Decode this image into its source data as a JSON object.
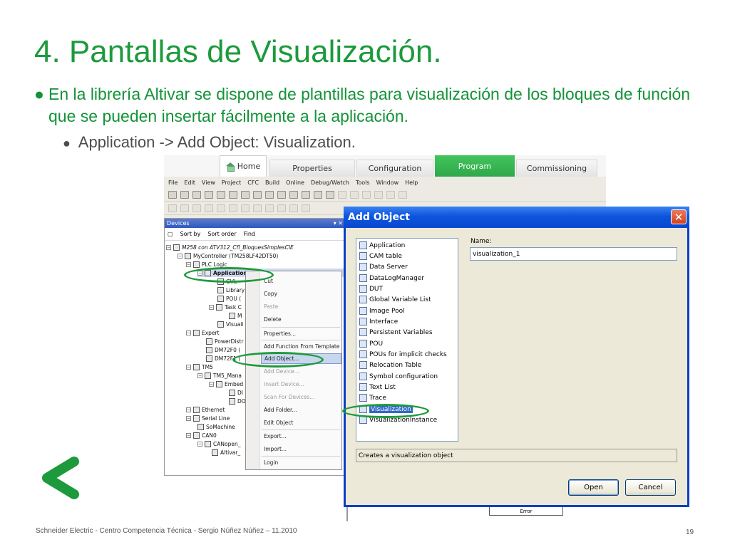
{
  "slide": {
    "title": "4. Pantallas de Visualización.",
    "bullet1": "En la librería Altivar se dispone de plantillas para visualización de los bloques de función que se pueden insertar fácilmente a la aplicación.",
    "bullet2": "Application -> Add Object: Visualization.",
    "bullet_glyph": "●",
    "footer": "Schneider Electric - Centro Competencia Técnica - Sergio Núñez Núñez – 11.2010",
    "page": "19",
    "accent_color": "#1c9a3c"
  },
  "ribbon": {
    "tabs": [
      "Home",
      "Properties",
      "Configuration",
      "Program",
      "Commissioning"
    ],
    "active": "Program"
  },
  "ide": {
    "menu": [
      "File",
      "Edit",
      "View",
      "Project",
      "CFC",
      "Build",
      "Online",
      "Debug/Watch",
      "Tools",
      "Window",
      "Help"
    ],
    "devices_title": "Devices",
    "devices_tools": [
      "Sort by",
      "Sort order",
      "Find"
    ],
    "tree": [
      "M258 con ATV312_Cfl_BloquesSimplesCIE",
      "MyController (TM258LF42DT50)",
      "PLC Logic",
      "Application",
      "GVL",
      "Library",
      "POU (",
      "Task C",
      "M",
      "Visuali",
      "Expert",
      "PowerDistr",
      "DM72F0 (",
      "DM72F1 (",
      "TM5",
      "TM5_Mana",
      "Embed",
      "DI",
      "DO",
      "Ethernet",
      "Serial Line",
      "SoMachine",
      "CAN0",
      "CANopen_",
      "Altivar_"
    ],
    "context_menu": [
      {
        "label": "Cut",
        "disabled": false
      },
      {
        "label": "Copy",
        "disabled": false
      },
      {
        "label": "Paste",
        "disabled": true
      },
      {
        "label": "Delete",
        "disabled": false
      },
      {
        "label": "Properties...",
        "disabled": false
      },
      {
        "label": "Add Function From Template",
        "disabled": false
      },
      {
        "label": "Add Object...",
        "disabled": false
      },
      {
        "label": "Add Device...",
        "disabled": true
      },
      {
        "label": "Insert Device...",
        "disabled": true
      },
      {
        "label": "Scan For Devices...",
        "disabled": true
      },
      {
        "label": "Add Folder...",
        "disabled": false
      },
      {
        "label": "Edit Object",
        "disabled": false
      },
      {
        "label": "Export...",
        "disabled": false
      },
      {
        "label": "Import...",
        "disabled": false
      },
      {
        "label": "Login",
        "disabled": false
      }
    ],
    "error_tag": "Error"
  },
  "dialog": {
    "title": "Add Object",
    "close_glyph": "✕",
    "objects": [
      "Application",
      "CAM table",
      "Data Server",
      "DataLogManager",
      "DUT",
      "Global Variable List",
      "Image Pool",
      "Interface",
      "Persistent Variables",
      "POU",
      "POUs for implicit checks",
      "Relocation Table",
      "Symbol configuration",
      "Text List",
      "Trace",
      "Visualization",
      "VisualizationInstance"
    ],
    "selected_object": "Visualization",
    "name_label": "Name:",
    "name_value": "visualization_1",
    "description": "Creates a visualization object",
    "open_button": "Open",
    "cancel_button": "Cancel"
  }
}
